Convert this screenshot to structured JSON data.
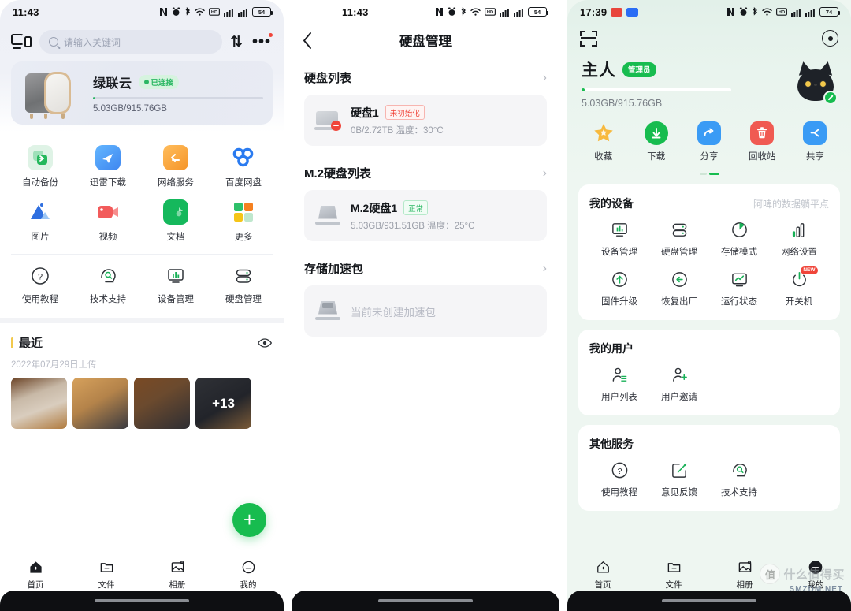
{
  "colors": {
    "green": "#17bc4f",
    "blue": "#3a9bf5",
    "orange": "#f5a623",
    "red": "#f0453a",
    "page_bg_light": "#ffffff",
    "page_bg_mint": "#eef6f1"
  },
  "panel1": {
    "statusbar": {
      "time": "11:43",
      "battery": "54"
    },
    "topbar": {
      "cast_label": "cast-icon",
      "search_placeholder": "请输入关键词",
      "sort_label": "⇅",
      "more_label": "•••"
    },
    "device_card": {
      "name": "绿联云",
      "status_badge": "已连接",
      "capacity": "5.03GB/915.76GB",
      "progress_percent": 1
    },
    "apps": [
      {
        "label": "自动备份",
        "icon": "auto-backup-icon",
        "color": "#2ec06a",
        "glyph": "↗"
      },
      {
        "label": "迅雷下载",
        "icon": "thunder-download-icon",
        "color": "#4aa3f8",
        "glyph": "✈"
      },
      {
        "label": "网络服务",
        "icon": "network-service-icon",
        "color": "#f5a623",
        "glyph": "‹—"
      },
      {
        "label": "百度网盘",
        "icon": "baidu-netdisk-icon",
        "color": "#2a7bf0",
        "glyph": "◉"
      },
      {
        "label": "图片",
        "icon": "photos-icon",
        "color": "#2f6fe0",
        "glyph": "▲"
      },
      {
        "label": "视频",
        "icon": "video-icon",
        "color": "#f25b5b",
        "glyph": "▶"
      },
      {
        "label": "文档",
        "icon": "documents-icon",
        "color": "#15b85c",
        "glyph": "▤"
      },
      {
        "label": "更多",
        "icon": "more-apps-icon",
        "color": "#f5a623",
        "glyph": "▦"
      }
    ],
    "tools": [
      {
        "label": "使用教程",
        "icon": "help-circle-icon"
      },
      {
        "label": "技术支持",
        "icon": "tech-support-icon"
      },
      {
        "label": "设备管理",
        "icon": "device-manage-icon"
      },
      {
        "label": "硬盘管理",
        "icon": "disk-manage-icon"
      }
    ],
    "recent": {
      "title": "最近",
      "date": "2022年07月29日上传",
      "eye_icon": "eye-icon",
      "more_count": "+13"
    },
    "fab_label": "+",
    "bottomnav": [
      {
        "label": "首页",
        "icon": "home-icon",
        "active": true
      },
      {
        "label": "文件",
        "icon": "folder-icon",
        "active": false
      },
      {
        "label": "相册",
        "icon": "album-icon",
        "active": false
      },
      {
        "label": "我的",
        "icon": "profile-icon",
        "active": false
      }
    ]
  },
  "panel2": {
    "statusbar": {
      "time": "11:43",
      "battery": "54"
    },
    "nav": {
      "back_icon": "back-chevron-icon",
      "title": "硬盘管理"
    },
    "sections": [
      {
        "title": "硬盘列表",
        "chevron": "›",
        "item": {
          "name": "硬盘1",
          "tag": "未初始化",
          "tag_type": "error",
          "detail": "0B/2.72TB  温度：30°C",
          "icon": "hdd-error-icon"
        }
      },
      {
        "title": "M.2硬盘列表",
        "chevron": "›",
        "item": {
          "name": "M.2硬盘1",
          "tag": "正常",
          "tag_type": "ok",
          "detail": "5.03GB/931.51GB  温度：25°C",
          "icon": "m2-ssd-icon"
        }
      },
      {
        "title": "存储加速包",
        "chevron": "›",
        "empty_text": "当前未创建加速包",
        "empty_icon": "ssd-empty-icon"
      }
    ]
  },
  "panel3": {
    "statusbar": {
      "time": "17:39",
      "battery": "74"
    },
    "topbar": {
      "scan_icon": "scan-icon",
      "settings_icon": "settings-icon"
    },
    "user": {
      "name": "主人",
      "role_badge": "管理员",
      "capacity": "5.03GB/915.76GB",
      "progress_percent": 1,
      "avatar": "cat-avatar",
      "edit_icon": "edit-pencil-icon"
    },
    "quick_actions": [
      {
        "label": "收藏",
        "icon": "star-icon",
        "color": "#f7b93e",
        "glyph": "★"
      },
      {
        "label": "下载",
        "icon": "download-icon",
        "color": "#17bc4f",
        "glyph": "↓"
      },
      {
        "label": "分享",
        "icon": "share-arrow-icon",
        "color": "#3a9bf5",
        "glyph": "↗"
      },
      {
        "label": "回收站",
        "icon": "trash-icon",
        "color": "#f05a52",
        "glyph": "🗑"
      },
      {
        "label": "共享",
        "icon": "share-node-icon",
        "color": "#3a9bf5",
        "glyph": "≻"
      }
    ],
    "pager": {
      "pages": 2,
      "active": 1
    },
    "my_device": {
      "title": "我的设备",
      "device_name": "阿啤的数据躺平点",
      "items": [
        {
          "label": "设备管理",
          "icon": "device-monitor-icon"
        },
        {
          "label": "硬盘管理",
          "icon": "disk-stack-icon"
        },
        {
          "label": "存储模式",
          "icon": "storage-pie-icon"
        },
        {
          "label": "网络设置",
          "icon": "network-bars-icon"
        },
        {
          "label": "固件升级",
          "icon": "firmware-upgrade-icon"
        },
        {
          "label": "恢复出厂",
          "icon": "factory-reset-icon"
        },
        {
          "label": "运行状态",
          "icon": "running-status-icon"
        },
        {
          "label": "开关机",
          "icon": "power-icon",
          "badge": "NEW"
        }
      ]
    },
    "my_users": {
      "title": "我的用户",
      "items": [
        {
          "label": "用户列表",
          "icon": "user-list-icon"
        },
        {
          "label": "用户邀请",
          "icon": "user-add-icon"
        }
      ]
    },
    "other_services": {
      "title": "其他服务",
      "items": [
        {
          "label": "使用教程",
          "icon": "help-circle-icon"
        },
        {
          "label": "意见反馈",
          "icon": "feedback-edit-icon"
        },
        {
          "label": "技术支持",
          "icon": "tech-support-icon"
        }
      ]
    },
    "bottomnav": [
      {
        "label": "首页",
        "icon": "home-icon",
        "active": false
      },
      {
        "label": "文件",
        "icon": "folder-icon",
        "active": false
      },
      {
        "label": "相册",
        "icon": "album-icon",
        "active": false
      },
      {
        "label": "我的",
        "icon": "profile-icon",
        "active": true
      }
    ],
    "watermark": {
      "mark": "值",
      "text": "什么值得买",
      "sub": "SMZDM.NET"
    }
  }
}
